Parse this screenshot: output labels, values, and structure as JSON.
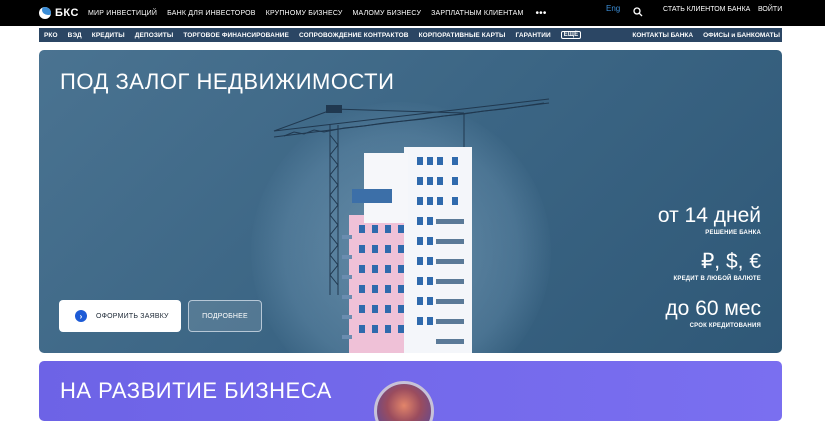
{
  "header": {
    "logo_text": "БКС",
    "nav": [
      "МИР ИНВЕСТИЦИЙ",
      "БАНК ДЛЯ ИНВЕСТОРОВ",
      "КРУПНОМУ БИЗНЕСУ",
      "МАЛОМУ БИЗНЕСУ",
      "ЗАРПЛАТНЫМ КЛИЕНТАМ"
    ],
    "more_dots": "•••",
    "lang": "Eng",
    "become_client": "СТАТЬ КЛИЕНТОМ БАНКА",
    "login": "ВОЙТИ"
  },
  "subnav": {
    "items": [
      "РКО",
      "ВЭД",
      "КРЕДИТЫ",
      "ДЕПОЗИТЫ",
      "ТОРГОВОЕ ФИНАНСИРОВАНИЕ",
      "СОПРОВОЖДЕНИЕ КОНТРАКТОВ",
      "КОРПОРАТИВНЫЕ КАРТЫ",
      "ГАРАНТИИ"
    ],
    "more": "ЕЩЁ",
    "right": [
      "КОНТАКТЫ БАНКА",
      "ОФИСЫ и БАНКОМАТЫ"
    ]
  },
  "hero": {
    "title": "ПОД ЗАЛОГ НЕДВИЖИМОСТИ",
    "apply_button": "ОФОРМИТЬ ЗАЯВКУ",
    "details_button": "ПОДРОБНЕЕ",
    "stats": [
      {
        "big": "от 14 дней",
        "small": "РЕШЕНИЕ БАНКА"
      },
      {
        "big": "₽, $, €",
        "small": "КРЕДИТ В ЛЮБОЙ ВАЛЮТЕ"
      },
      {
        "big": "до 60 мес",
        "small": "СРОК КРЕДИТОВАНИЯ"
      }
    ]
  },
  "hero2": {
    "title": "НА РАЗВИТИЕ БИЗНЕСА"
  },
  "colors": {
    "topbar": "#000000",
    "subnav": "#2b4664",
    "hero": "#3b6584",
    "hero2": "#7468ec",
    "accent": "#1d5bd6"
  }
}
